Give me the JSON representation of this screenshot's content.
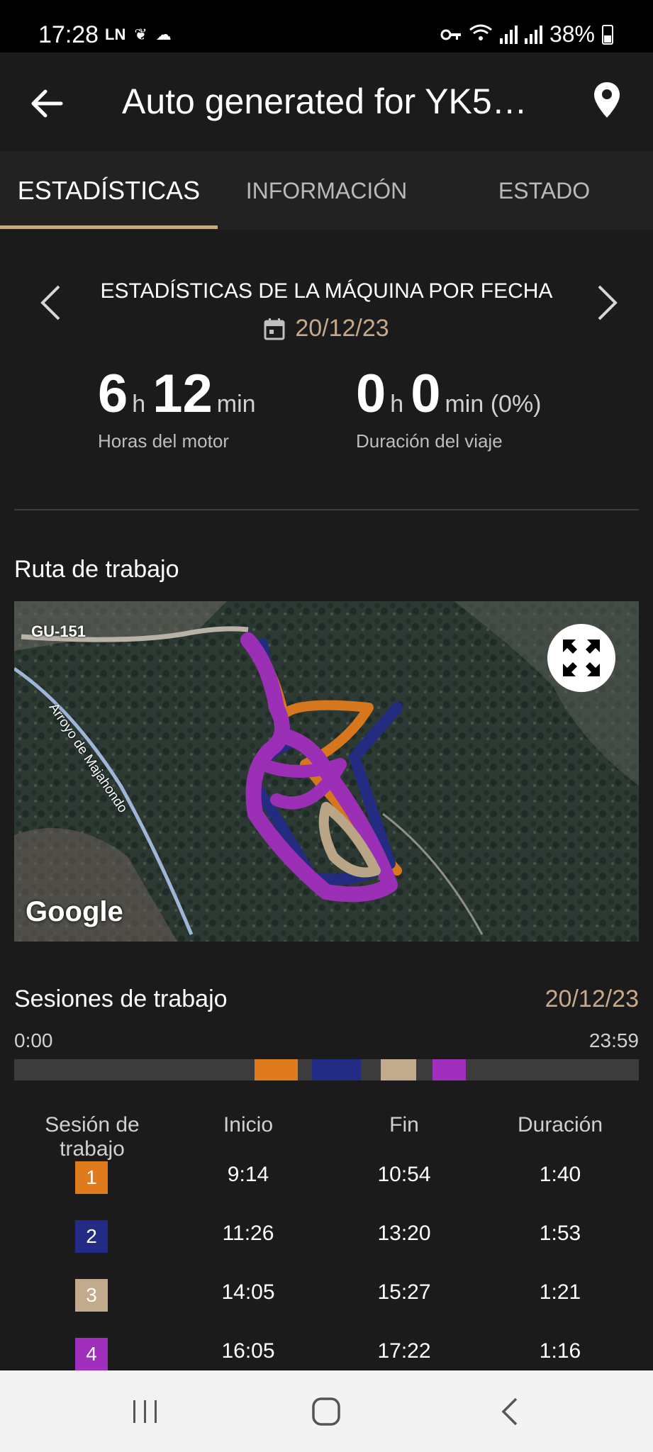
{
  "status_bar": {
    "time": "17:28",
    "left_icons": [
      "LN",
      "flower-icon",
      "cloud-chat-icon"
    ],
    "battery": "38%"
  },
  "app_bar": {
    "title": "Auto generated for YK5…",
    "back_icon": "arrow-left-icon",
    "location_icon": "map-pin-icon"
  },
  "tabs": [
    {
      "label": "ESTADÍSTICAS",
      "active": true
    },
    {
      "label": "INFORMACIÓN",
      "active": false
    },
    {
      "label": "ESTADO",
      "active": false
    }
  ],
  "stats": {
    "title": "ESTADÍSTICAS DE LA MÁQUINA POR FECHA",
    "date": "20/12/23",
    "engine": {
      "hours": "6",
      "h": "h",
      "minutes": "12",
      "min": "min",
      "label": "Horas del motor"
    },
    "trip": {
      "hours": "0",
      "h": "h",
      "minutes": "0",
      "min": "min (0%)",
      "label": "Duración del viaje"
    }
  },
  "route": {
    "title": "Ruta de trabajo",
    "road_label": "GU-151",
    "river_label": "Arroyo de Majahondo",
    "map_logo": "Google"
  },
  "sessions": {
    "title": "Sesiones de trabajo",
    "date": "20/12/23",
    "timeline_start": "0:00",
    "timeline_end": "23:59",
    "headers": [
      "Sesión de trabajo",
      "Inicio",
      "Fin",
      "Duración"
    ],
    "rows": [
      {
        "id": "1",
        "color": "#e07b1d",
        "start": "9:14",
        "end": "10:54",
        "duration": "1:40"
      },
      {
        "id": "2",
        "color": "#232c85",
        "start": "11:26",
        "end": "13:20",
        "duration": "1:53"
      },
      {
        "id": "3",
        "color": "#c2ab8c",
        "start": "14:05",
        "end": "15:27",
        "duration": "1:21"
      },
      {
        "id": "4",
        "color": "#a12fbd",
        "start": "16:05",
        "end": "17:22",
        "duration": "1:16"
      }
    ]
  },
  "colors": {
    "accent": "#c8aa85",
    "background": "#1b1b1b"
  }
}
